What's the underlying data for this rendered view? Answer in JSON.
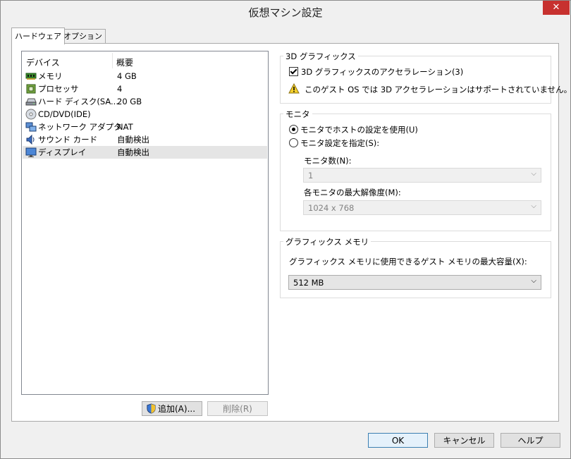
{
  "window": {
    "title": "仮想マシン設定",
    "close_label": "✕"
  },
  "tabs": [
    {
      "label": "ハードウェア",
      "active": true
    },
    {
      "label": "オプション",
      "active": false
    }
  ],
  "device_list": {
    "columns": [
      "デバイス",
      "概要"
    ],
    "rows": [
      {
        "name": "メモリ",
        "summary": "4 GB",
        "icon": "memory-icon"
      },
      {
        "name": "プロセッサ",
        "summary": "4",
        "icon": "processor-icon"
      },
      {
        "name": "ハード ディスク(SA...",
        "summary": "20 GB",
        "icon": "hard-disk-icon"
      },
      {
        "name": "CD/DVD(IDE)",
        "summary": "",
        "icon": "cd-dvd-icon"
      },
      {
        "name": "ネットワーク アダプタ",
        "summary": "NAT",
        "icon": "network-adapter-icon"
      },
      {
        "name": "サウンド カード",
        "summary": "自動検出",
        "icon": "sound-card-icon"
      },
      {
        "name": "ディスプレイ",
        "summary": "自動検出",
        "icon": "display-icon",
        "selected": true
      }
    ]
  },
  "list_buttons": {
    "add": "追加(A)...",
    "remove": "削除(R)"
  },
  "graphics3d": {
    "title": "3D グラフィックス",
    "accel_label": "3D グラフィックスのアクセラレーション(3)",
    "accel_checked": true,
    "warning": "このゲスト OS では 3D アクセラレーションはサポートされていません。"
  },
  "monitor": {
    "title": "モニタ",
    "use_host_label": "モニタでホストの設定を使用(U)",
    "specify_label": "モニタ設定を指定(S):",
    "count_label": "モニタ数(N):",
    "count_value": "1",
    "max_res_label": "各モニタの最大解像度(M):",
    "max_res_value": "1024 x 768"
  },
  "graphics_memory": {
    "title": "グラフィックス メモリ",
    "max_label": "グラフィックス メモリに使用できるゲスト メモリの最大容量(X):",
    "value": "512 MB"
  },
  "footer": {
    "ok": "OK",
    "cancel": "キャンセル",
    "help": "ヘルプ"
  }
}
